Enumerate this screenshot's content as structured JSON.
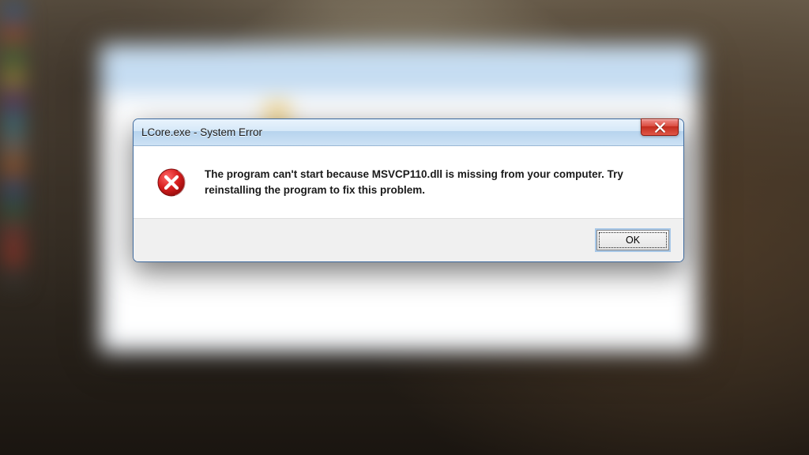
{
  "dialog": {
    "title": "LCore.exe - System Error",
    "message": "The program can't start because MSVCP110.dll is missing from your computer. Try reinstalling the program to fix this problem.",
    "ok_label": "OK",
    "icon": "error-icon"
  }
}
